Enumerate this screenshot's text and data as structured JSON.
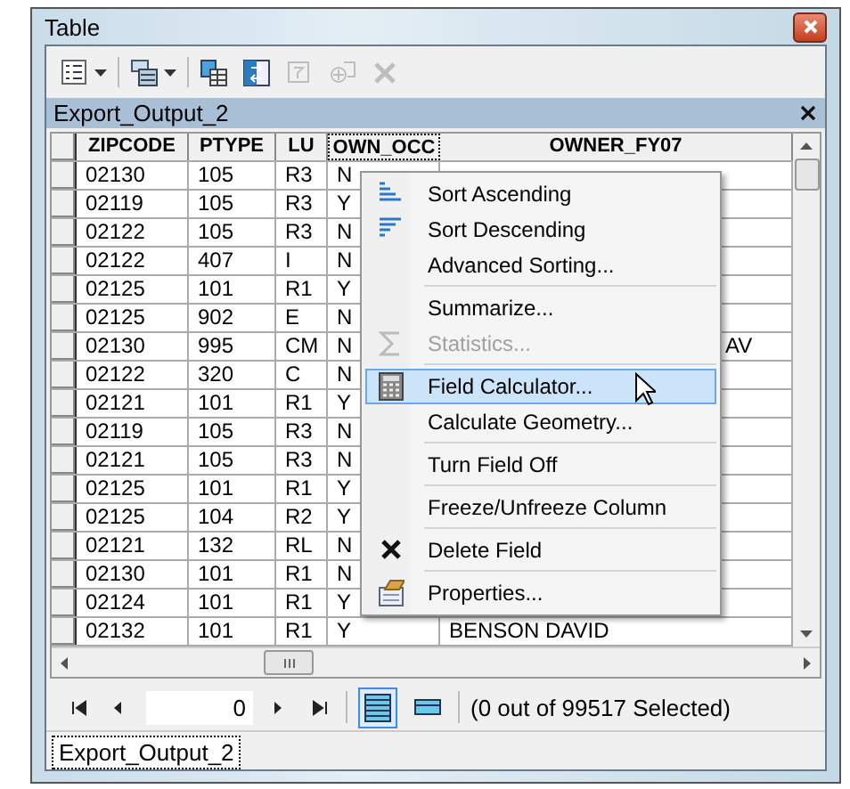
{
  "window": {
    "title": "Table"
  },
  "toolbar": [
    {
      "kind": "options",
      "disabled": false,
      "dropdown": true
    },
    {
      "kind": "related",
      "disabled": false,
      "dropdown": true
    },
    {
      "kind": "select",
      "disabled": false,
      "dropdown": false
    },
    {
      "kind": "switch",
      "disabled": false,
      "dropdown": false
    },
    {
      "kind": "clear",
      "disabled": true,
      "dropdown": false
    },
    {
      "kind": "zoom",
      "disabled": true,
      "dropdown": false
    },
    {
      "kind": "delete",
      "disabled": true,
      "dropdown": false
    }
  ],
  "table_tab": {
    "title": "Export_Output_2"
  },
  "table": {
    "columns": [
      {
        "label": "ZIPCODE",
        "selected": false
      },
      {
        "label": "PTYPE",
        "selected": false
      },
      {
        "label": "LU",
        "selected": false
      },
      {
        "label": "OWN_OCC",
        "selected": true
      },
      {
        "label": "OWNER_FY07",
        "selected": false
      }
    ],
    "rows": [
      [
        "02130",
        "105",
        "R3",
        "N",
        ""
      ],
      [
        "02119",
        "105",
        "R3",
        "Y",
        ""
      ],
      [
        "02122",
        "105",
        "R3",
        "N",
        ""
      ],
      [
        "02122",
        "407",
        "I",
        "N",
        ""
      ],
      [
        "02125",
        "101",
        "R1",
        "Y",
        ""
      ],
      [
        "02125",
        "902",
        "E",
        "N",
        ""
      ],
      [
        "02130",
        "995",
        "CM",
        "N",
        "AV"
      ],
      [
        "02122",
        "320",
        "C",
        "N",
        ""
      ],
      [
        "02121",
        "101",
        "R1",
        "Y",
        ""
      ],
      [
        "02119",
        "105",
        "R3",
        "N",
        ""
      ],
      [
        "02121",
        "105",
        "R3",
        "N",
        ""
      ],
      [
        "02125",
        "101",
        "R1",
        "Y",
        ""
      ],
      [
        "02125",
        "104",
        "R2",
        "Y",
        ""
      ],
      [
        "02121",
        "132",
        "RL",
        "N",
        ""
      ],
      [
        "02130",
        "101",
        "R1",
        "N",
        ""
      ],
      [
        "02124",
        "101",
        "R1",
        "Y",
        ""
      ],
      [
        "02132",
        "101",
        "R1",
        "Y",
        "BENSON DAVID"
      ]
    ]
  },
  "context_menu": [
    {
      "label": "Sort Ascending",
      "separator_before": false,
      "disabled": false,
      "selected": false
    },
    {
      "label": "Sort Descending",
      "separator_before": false,
      "disabled": false,
      "selected": false
    },
    {
      "label": "Advanced Sorting...",
      "separator_before": false,
      "disabled": false,
      "selected": false
    },
    {
      "label": "Summarize...",
      "separator_before": true,
      "disabled": false,
      "selected": false
    },
    {
      "label": "Statistics...",
      "separator_before": false,
      "disabled": true,
      "selected": false
    },
    {
      "label": "Field Calculator...",
      "separator_before": true,
      "disabled": false,
      "selected": true
    },
    {
      "label": "Calculate Geometry...",
      "separator_before": false,
      "disabled": false,
      "selected": false
    },
    {
      "label": "Turn Field Off",
      "separator_before": true,
      "disabled": false,
      "selected": false
    },
    {
      "label": "Freeze/Unfreeze Column",
      "separator_before": true,
      "disabled": false,
      "selected": false
    },
    {
      "label": "Delete Field",
      "separator_before": true,
      "disabled": false,
      "selected": false
    },
    {
      "label": "Properties...",
      "separator_before": true,
      "disabled": false,
      "selected": false
    }
  ],
  "navigation": {
    "record": "0",
    "views": [
      {
        "kind": "all",
        "selected": true
      },
      {
        "kind": "selected",
        "selected": false
      }
    ],
    "status": "(0 out of 99517 Selected)"
  },
  "bottom_tabs": [
    {
      "label": "Export_Output_2",
      "selected": true
    }
  ]
}
